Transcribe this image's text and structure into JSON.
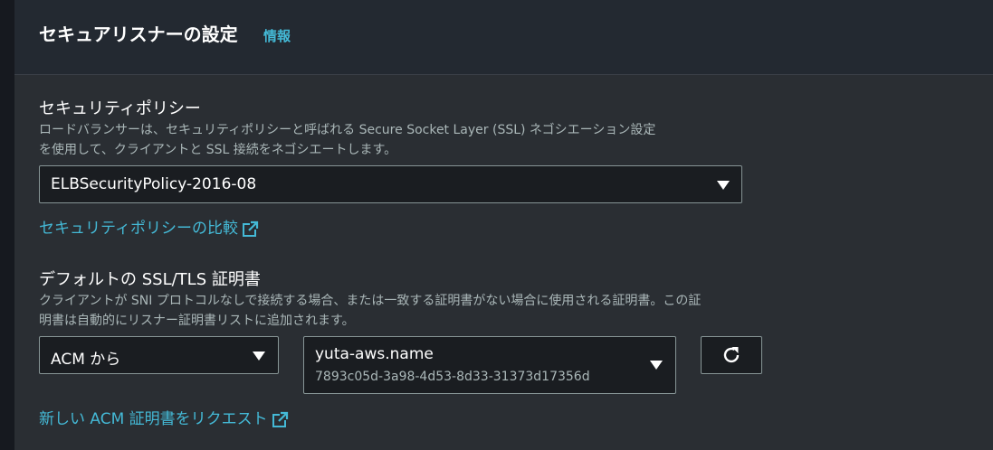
{
  "header": {
    "title": "セキュアリスナーの設定",
    "info_link": "情報"
  },
  "security_policy": {
    "label": "セキュリティポリシー",
    "description_line1": "ロードバランサーは、セキュリティポリシーと呼ばれる Secure Socket Layer (SSL) ネゴシエーション設定",
    "description_line2": "を使用して、クライアントと SSL 接続をネゴシエートします。",
    "selected": "ELBSecurityPolicy-2016-08",
    "compare_link": "セキュリティポリシーの比較"
  },
  "default_cert": {
    "label": "デフォルトの SSL/TLS 証明書",
    "description_line1": "クライアントが SNI プロトコルなしで接続する場合、または一致する証明書がない場合に使用される証明書。この証",
    "description_line2": "明書は自動的にリスナー証明書リストに追加されます。",
    "source_selected": "ACM から",
    "certificate_name": "yuta-aws.name",
    "certificate_id": "7893c05d-3a98-4d53-8d33-31373d17356d",
    "request_link": "新しい ACM 証明書をリクエスト"
  },
  "icons": {
    "external": "external-link-icon",
    "refresh": "refresh-icon",
    "caret": "caret-down-icon"
  },
  "colors": {
    "link": "#44b9d6",
    "background": "#2a2e33",
    "input_background": "#1a1d21",
    "border": "#879596"
  }
}
